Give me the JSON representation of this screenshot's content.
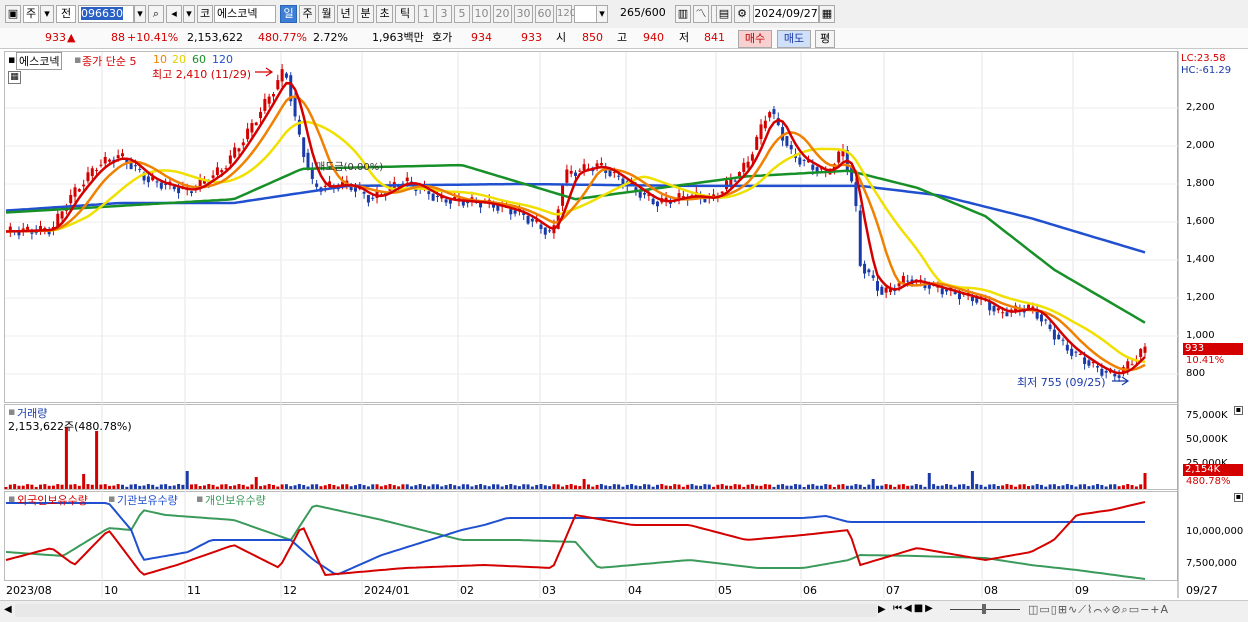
{
  "toolbar": {
    "market": "주",
    "prev_label": "전",
    "code": "096630",
    "exchange_icon": "코",
    "stock_name": "에스코넥",
    "periods": [
      "일",
      "주",
      "월",
      "년",
      "분",
      "초",
      "틱"
    ],
    "selected_period": "일",
    "intervals": [
      "1",
      "3",
      "5",
      "10",
      "20",
      "30",
      "60",
      "120"
    ],
    "count": "265",
    "count_max": "/600",
    "date": "2024/09/27"
  },
  "quote": {
    "price": "933",
    "arrow": "▲",
    "change": "88",
    "change_pct": "+10.41%",
    "volume": "2,153,622",
    "volume_pct": "480.77%",
    "turnover": "2.72%",
    "amount": "1,963백만",
    "bid_label": "호가",
    "bid": "934",
    "ask": "933",
    "open_label": "시",
    "open": "850",
    "high_label": "고",
    "high": "940",
    "low_label": "저",
    "low": "841",
    "buy_label": "매수",
    "sell_label": "매도",
    "eval_label": "평"
  },
  "price_panel": {
    "stock_tab": "에스코넥",
    "legend_title": "종가 단순",
    "ma_periods": [
      "5",
      "10",
      "20",
      "60",
      "120"
    ],
    "ma_colors": [
      "#d40000",
      "#f08000",
      "#f0e000",
      "#189028",
      "#2050d0"
    ],
    "high_note": "최고 2,410 (11/29)",
    "low_note": "최저 755 (09/25)",
    "lock_note": "매도금(0.00%)",
    "lc": "LC:23.58",
    "hc": "HC:-61.29",
    "y_ticks": [
      "2,200",
      "2,000",
      "1,800",
      "1,600",
      "1,400",
      "1,200",
      "1,000",
      "800"
    ],
    "current_price_tag": "933",
    "current_pct_tag": "10.41%"
  },
  "volume_panel": {
    "title": "거래량",
    "value": "2,153,622주(480.78%)",
    "y_ticks": [
      "75,000K",
      "50,000K",
      "25,000K"
    ],
    "current_tag": "2,154K",
    "pct_tag": "480.78%"
  },
  "holdings_panel": {
    "legend": [
      "외국인보유수량",
      "기관보유수량",
      "개인보유수량"
    ],
    "colors": [
      "#d40000",
      "#2050d0",
      "#3a9a5a"
    ],
    "y_ticks": [
      "10,000,000",
      "7,500,000"
    ]
  },
  "x_axis": [
    "2023/08",
    "10",
    "11",
    "12",
    "2024/01",
    "02",
    "03",
    "04",
    "05",
    "06",
    "07",
    "08",
    "09"
  ],
  "x_last": "09/27",
  "chart_data": {
    "type": "line",
    "title": "",
    "series": [
      {
        "name": "종가",
        "x": [
          "2023/08",
          "2023/09",
          "2023/10",
          "2023/11",
          "2023/11/29",
          "2024/01",
          "2024/02",
          "2024/03",
          "2024/04",
          "2024/05",
          "2024/05/20",
          "2024/06",
          "2024/07",
          "2024/08",
          "2024/09/25",
          "2024/09/27"
        ],
        "values": [
          1550,
          1650,
          1950,
          1800,
          2410,
          1750,
          1700,
          1520,
          1800,
          1750,
          2200,
          1850,
          1250,
          1150,
          755,
          933
        ]
      },
      {
        "name": "120",
        "x": [
          "2023/08",
          "2023/11",
          "2024/01",
          "2024/06",
          "2024/07",
          "2024/09/27"
        ],
        "values": [
          1650,
          1700,
          1800,
          1790,
          1750,
          1440
        ]
      },
      {
        "name": "60",
        "x": [
          "2023/08",
          "2023/11",
          "2023/12",
          "2024/03",
          "2024/06",
          "2024/07",
          "2024/09/27"
        ],
        "values": [
          1600,
          1720,
          1880,
          1720,
          1870,
          1650,
          1070
        ]
      }
    ],
    "ylim": [
      700,
      2400
    ]
  }
}
